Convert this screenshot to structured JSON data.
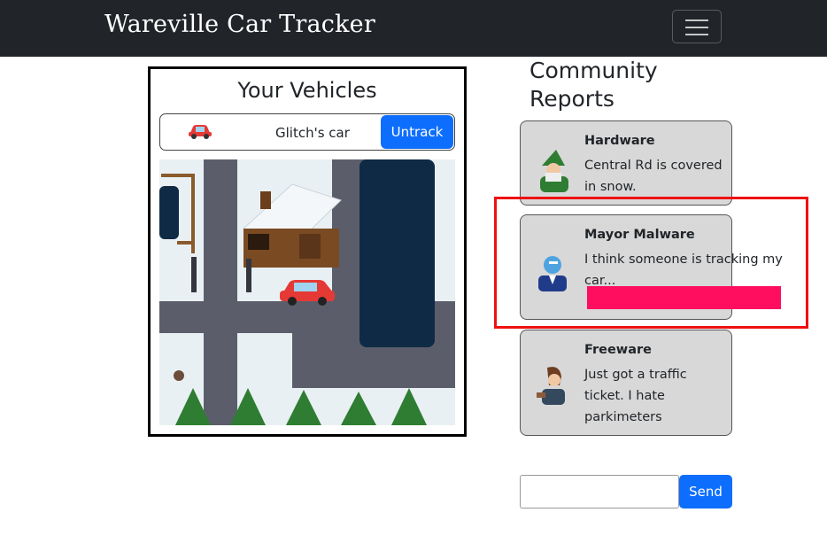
{
  "navbar": {
    "brand": "Wareville Car Tracker",
    "toggle_icon": "hamburger-icon"
  },
  "vehicles": {
    "title": "Your Vehicles",
    "items": [
      {
        "icon": "car-icon",
        "name": "Glitch's car",
        "action_label": "Untrack"
      }
    ],
    "map_icon": "car-icon"
  },
  "reports": {
    "title": "Community Reports",
    "items": [
      {
        "user": "Hardware",
        "text": "Central Rd is covered in snow.",
        "avatar": "elf-avatar"
      },
      {
        "user": "Mayor Malware",
        "text": "I think someone is tracking my car...",
        "avatar": "mayor-avatar"
      },
      {
        "user": "Freeware",
        "text": "Just got a traffic ticket. I hate parkimeters",
        "avatar": "freeware-avatar"
      }
    ]
  },
  "composer": {
    "input_value": "",
    "send_label": "Send"
  },
  "colors": {
    "accent": "#0d6efd",
    "navbar": "#212529",
    "highlight": "#ee1111",
    "redaction": "#ff0e5f"
  }
}
